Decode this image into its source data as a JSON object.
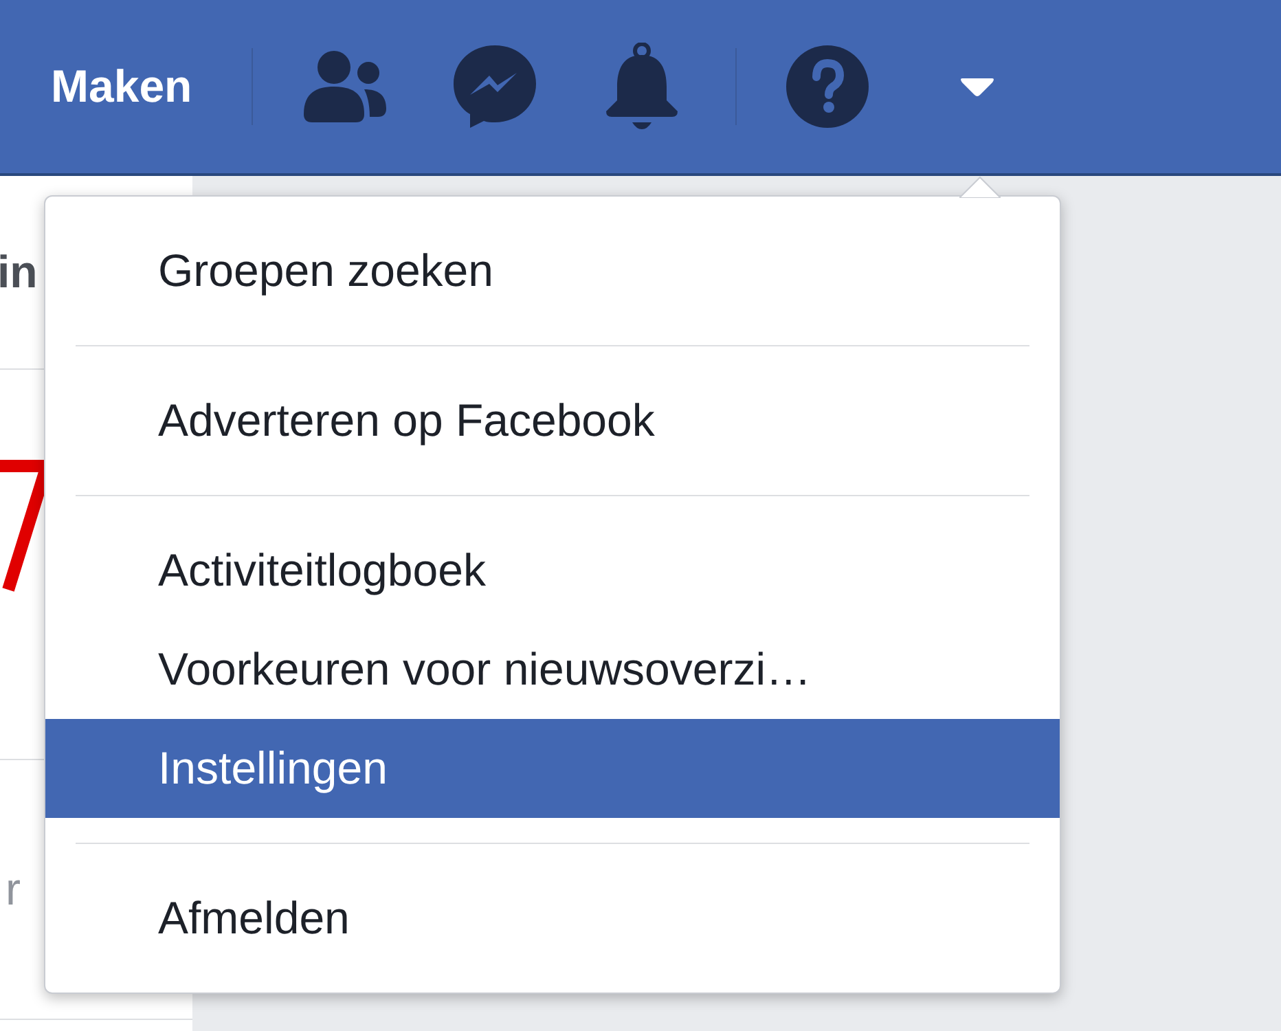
{
  "top_bar": {
    "create_label": "Maken"
  },
  "background": {
    "texts": [
      "in",
      "r"
    ]
  },
  "menu": {
    "groups": [
      [
        {
          "label": "Groepen zoeken",
          "selected": false
        }
      ],
      [
        {
          "label": "Adverteren op Facebook",
          "selected": false
        }
      ],
      [
        {
          "label": "Activiteitlogboek",
          "selected": false
        },
        {
          "label": "Voorkeuren voor nieuwsoverzi…",
          "selected": false
        },
        {
          "label": "Instellingen",
          "selected": true
        }
      ],
      [
        {
          "label": "Afmelden",
          "selected": false
        }
      ]
    ]
  }
}
